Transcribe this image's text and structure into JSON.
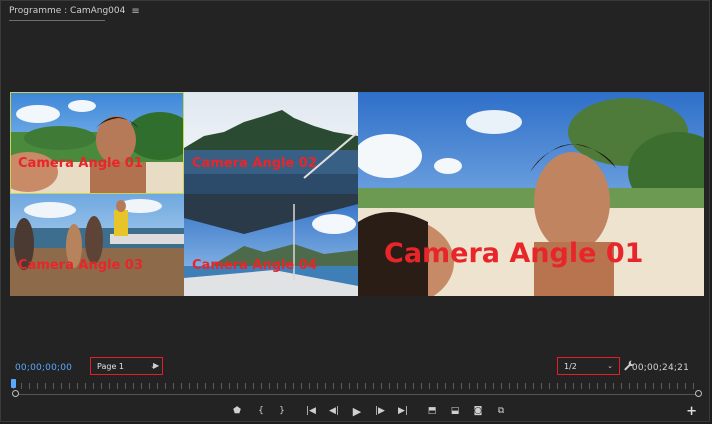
{
  "panel": {
    "title": "Programme : CamAng004",
    "menu_glyph": "≡"
  },
  "cameras": [
    {
      "label": "Camera Angle 01",
      "selected": true
    },
    {
      "label": "Camera Angle 02",
      "selected": false
    },
    {
      "label": "Camera Angle 03",
      "selected": false
    },
    {
      "label": "Camera Angle 04",
      "selected": false
    }
  ],
  "program_monitor": {
    "label": "Camera Angle 01"
  },
  "controls": {
    "timecode_current": "00;00;00;00",
    "timecode_duration": "00;00;24;21",
    "page_select": "Page 1",
    "page_arrow": "▶",
    "resolution_select": "1/2",
    "chevron": "⌄",
    "wrench_icon": "🔧"
  },
  "transport": {
    "buttons": [
      {
        "name": "add-marker-button",
        "glyph": "⬟"
      },
      {
        "name": "mark-in-button",
        "glyph": "{"
      },
      {
        "name": "mark-out-button",
        "glyph": "}"
      },
      {
        "name": "go-to-in-button",
        "glyph": "|◀"
      },
      {
        "name": "step-back-button",
        "glyph": "◀|"
      },
      {
        "name": "play-button",
        "glyph": "▶"
      },
      {
        "name": "step-forward-button",
        "glyph": "|▶"
      },
      {
        "name": "go-to-out-button",
        "glyph": "▶|"
      },
      {
        "name": "lift-button",
        "glyph": "⬒"
      },
      {
        "name": "extract-button",
        "glyph": "⬓"
      },
      {
        "name": "export-frame-button",
        "glyph": "◙"
      },
      {
        "name": "comparison-view-button",
        "glyph": "⧉"
      }
    ],
    "add_button": "+"
  },
  "colors": {
    "accent_blue": "#5aa8ff",
    "highlight_red": "#e01f26",
    "camera_label_red": "#e8262a",
    "selected_outline": "#c8d35a"
  }
}
